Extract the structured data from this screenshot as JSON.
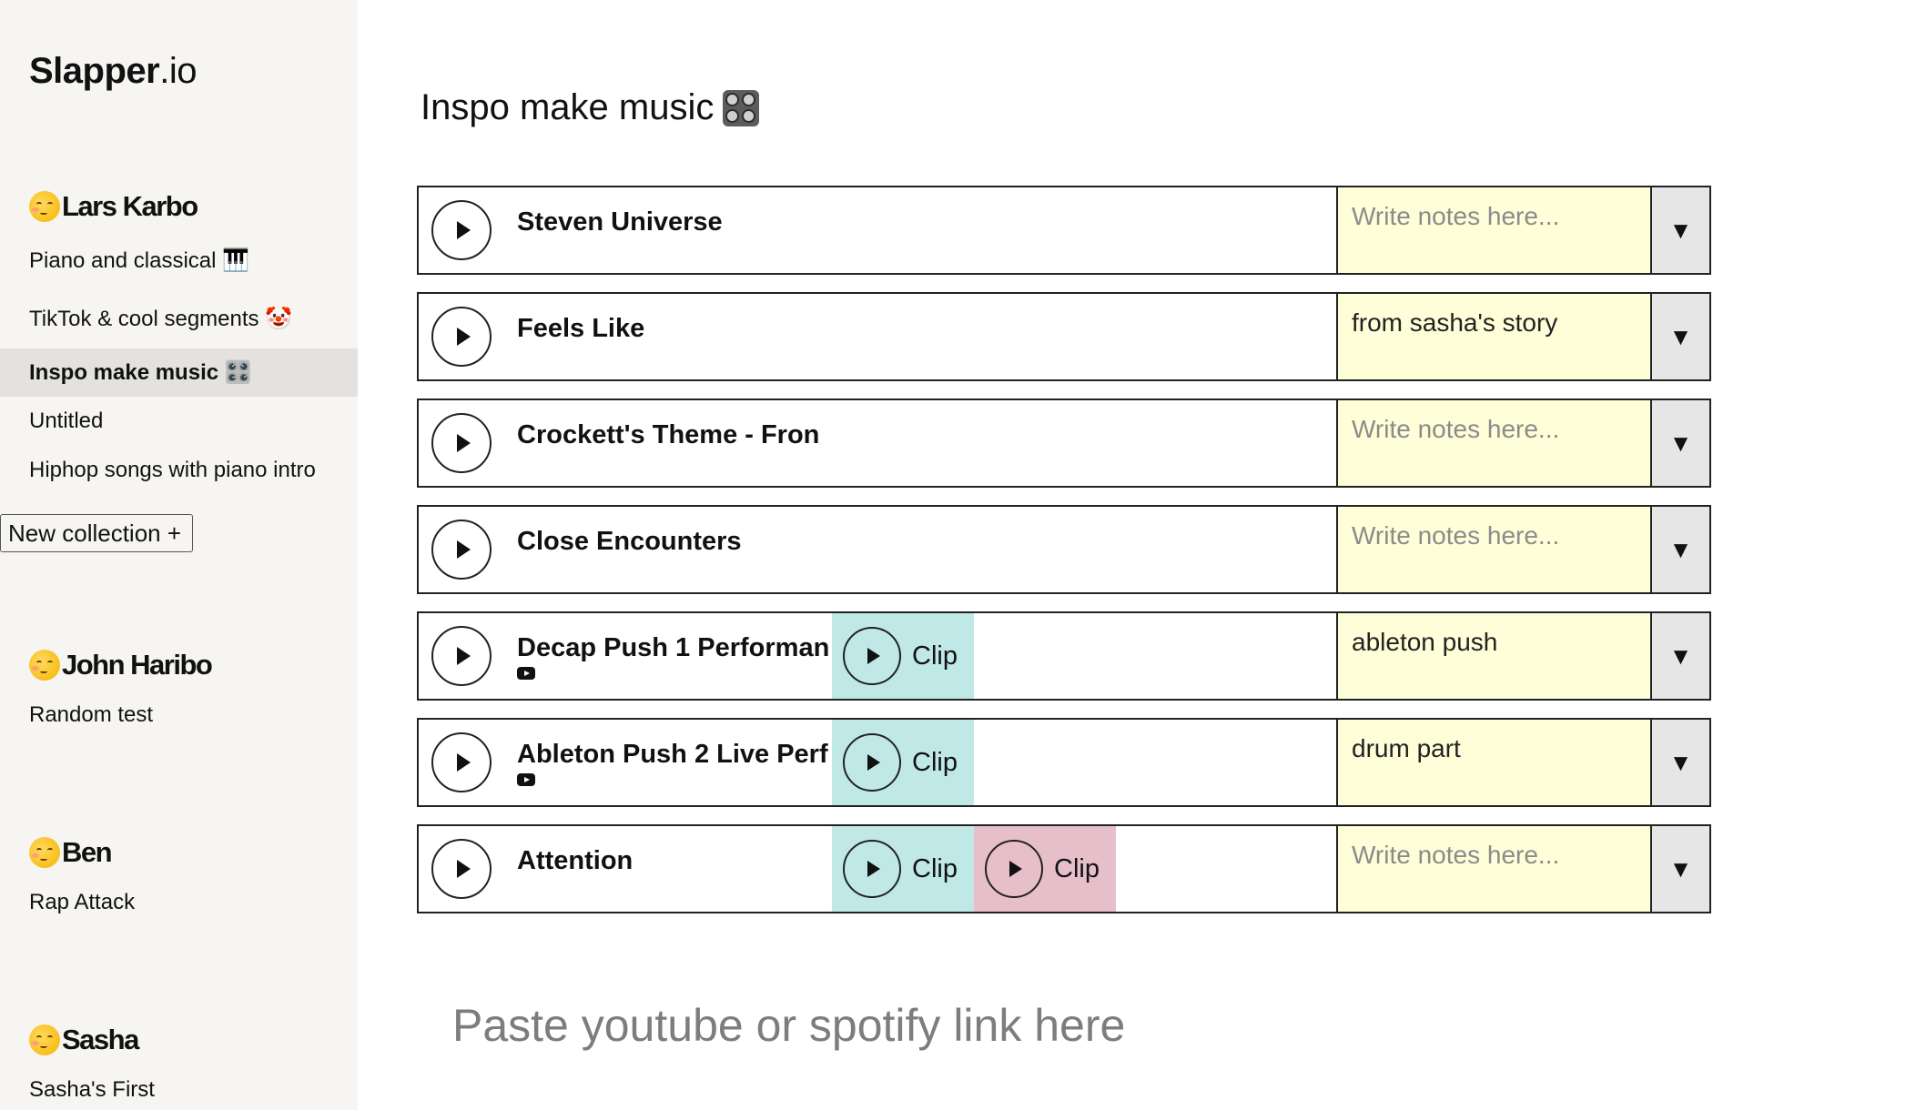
{
  "app": {
    "brand": "Slapper",
    "tld": ".io"
  },
  "sidebar": {
    "users": [
      {
        "name": "Lars Karbo",
        "collections": [
          "Piano and classical 🎹",
          "TikTok & cool segments 🤡",
          "Inspo make music 🎛️",
          "Untitled",
          "Hiphop songs with piano intro"
        ]
      },
      {
        "name": "John Haribo",
        "collections": [
          "Random test"
        ]
      },
      {
        "name": "Ben",
        "collections": [
          "Rap Attack"
        ]
      },
      {
        "name": "Sasha",
        "collections": [
          "Sasha's First"
        ]
      }
    ],
    "active_collection": "Inspo make music",
    "new_collection_label": "New collection +"
  },
  "page": {
    "title": "Inspo make music"
  },
  "tracks": [
    {
      "title": "Steven Universe",
      "source": "spotify",
      "clips": [],
      "notes": "",
      "notes_placeholder": "Write notes here..."
    },
    {
      "title": "Feels Like",
      "source": "spotify",
      "clips": [],
      "notes": "from sasha's story",
      "notes_placeholder": "Write notes here..."
    },
    {
      "title": "Crockett's Theme - Fron",
      "source": "spotify",
      "clips": [],
      "notes": "",
      "notes_placeholder": "Write notes here..."
    },
    {
      "title": "Close Encounters",
      "source": "spotify",
      "clips": [],
      "notes": "",
      "notes_placeholder": "Write notes here..."
    },
    {
      "title": "Decap Push 1 Performan",
      "source": "youtube",
      "clips": [
        {
          "label": "Clip",
          "color": "#bfe8e6"
        }
      ],
      "notes": "ableton push",
      "notes_placeholder": "Write notes here..."
    },
    {
      "title": "Ableton Push 2 Live Perf",
      "source": "youtube",
      "clips": [
        {
          "label": "Clip",
          "color": "#bfe8e6"
        }
      ],
      "notes": "drum part",
      "notes_placeholder": "Write notes here..."
    },
    {
      "title": "Attention",
      "source": "spotify",
      "clips": [
        {
          "label": "Clip",
          "color": "#bfe8e6"
        },
        {
          "label": "Clip",
          "color": "#e7bfca"
        }
      ],
      "notes": "",
      "notes_placeholder": "Write notes here..."
    }
  ],
  "paste_placeholder": "Paste youtube or spotify link here",
  "icons": {
    "play": "play-icon",
    "dropdown": "caret-down-icon",
    "spotify": "spotify-icon",
    "youtube": "youtube-icon"
  }
}
